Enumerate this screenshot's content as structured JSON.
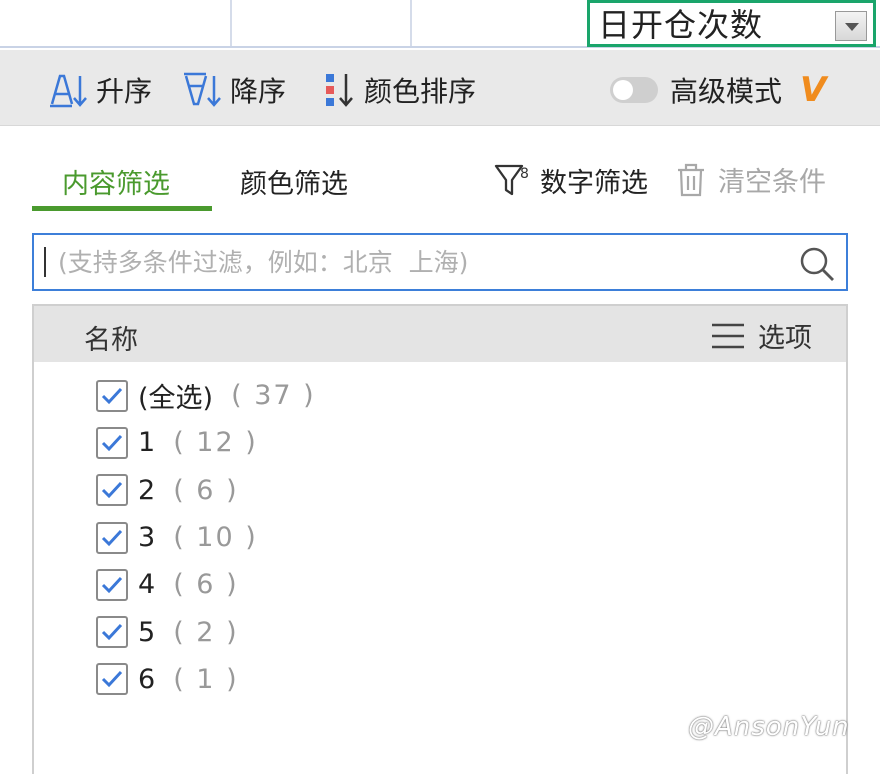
{
  "cell": {
    "header_text": "日开仓次数"
  },
  "sort_bar": {
    "asc_label": "升序",
    "desc_label": "降序",
    "color_sort_label": "颜色排序",
    "advanced_mode_label": "高级模式",
    "advanced_mode_on": false,
    "vip_badge": "V"
  },
  "tabs": {
    "content_filter": "内容筛选",
    "color_filter": "颜色筛选",
    "active": "content_filter"
  },
  "actions": {
    "number_filter": "数字筛选",
    "clear_conditions": "清空条件"
  },
  "search": {
    "placeholder": "(支持多条件过滤，例如：北京  上海)",
    "value": ""
  },
  "list": {
    "header_name": "名称",
    "options_label": "选项",
    "items": [
      {
        "label": "(全选)",
        "count": "( 37 )",
        "checked": true
      },
      {
        "label": "1",
        "count": "( 12 )",
        "checked": true
      },
      {
        "label": "2",
        "count": "( 6 )",
        "checked": true
      },
      {
        "label": "3",
        "count": "( 10 )",
        "checked": true
      },
      {
        "label": "4",
        "count": "( 6 )",
        "checked": true
      },
      {
        "label": "5",
        "count": "( 2 )",
        "checked": true
      },
      {
        "label": "6",
        "count": "( 1 )",
        "checked": true
      }
    ]
  },
  "watermark": "@AnsonYun",
  "colors": {
    "accent_green": "#4a9a2e",
    "active_cell_border": "#1aa56b",
    "search_border": "#3d7fd9",
    "vip_orange": "#f08c1e",
    "sort_icon_blue": "#3b78d8"
  },
  "icons": {
    "asc": "sort-ascending-icon",
    "desc": "sort-descending-icon",
    "color_sort": "color-sort-icon",
    "number_filter": "funnel-icon",
    "clear": "trash-icon",
    "search": "search-icon",
    "options": "menu-lines-icon",
    "checkbox": "checkmark-icon",
    "dropdown": "dropdown-arrow-icon"
  }
}
